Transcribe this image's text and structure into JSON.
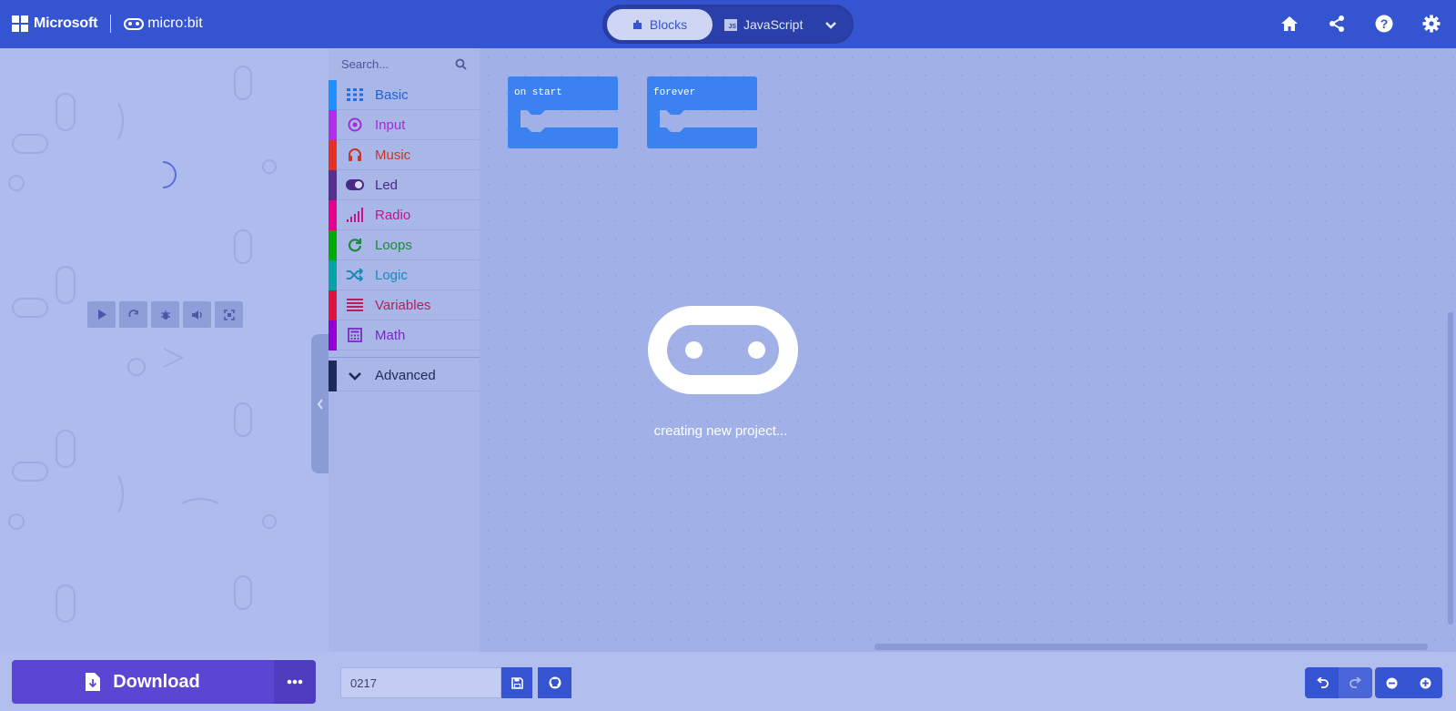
{
  "header": {
    "brand_microsoft": "Microsoft",
    "brand_product": "micro:bit",
    "mode_blocks": "Blocks",
    "mode_javascript": "JavaScript",
    "js_badge": "JS",
    "icons": [
      "home-icon",
      "share-icon",
      "help-icon",
      "settings-icon"
    ]
  },
  "simulator": {
    "controls": [
      "play-icon",
      "restart-icon",
      "debug-icon",
      "mute-icon",
      "fullscreen-icon"
    ]
  },
  "toolbox": {
    "search_placeholder": "Search...",
    "categories": [
      {
        "label": "Basic",
        "color": "#1e90ff",
        "icon": "grid-icon"
      },
      {
        "label": "Input",
        "color": "#b32ee8",
        "icon": "target-icon"
      },
      {
        "label": "Music",
        "color": "#e63022",
        "icon": "headphones-icon"
      },
      {
        "label": "Led",
        "color": "#5c2d91",
        "icon": "toggle-icon"
      },
      {
        "label": "Radio",
        "color": "#e3008c",
        "icon": "signal-icon"
      },
      {
        "label": "Loops",
        "color": "#00aa00",
        "icon": "refresh-icon"
      },
      {
        "label": "Logic",
        "color": "#00a4a6",
        "icon": "shuffle-icon"
      },
      {
        "label": "Variables",
        "color": "#dc143c",
        "icon": "list-icon"
      },
      {
        "label": "Math",
        "color": "#9400d3",
        "icon": "calculator-icon"
      },
      {
        "label": "Advanced",
        "color": "#3c3c3c",
        "icon": "chevron-down-icon"
      }
    ]
  },
  "workspace": {
    "blocks": [
      "on start",
      "forever"
    ],
    "block_color": "#1e90ff",
    "loading_text": "creating new project..."
  },
  "bottom": {
    "download_label": "Download",
    "project_name": "0217"
  },
  "colors": {
    "header": "#3454d1",
    "download": "#5b46d3"
  }
}
